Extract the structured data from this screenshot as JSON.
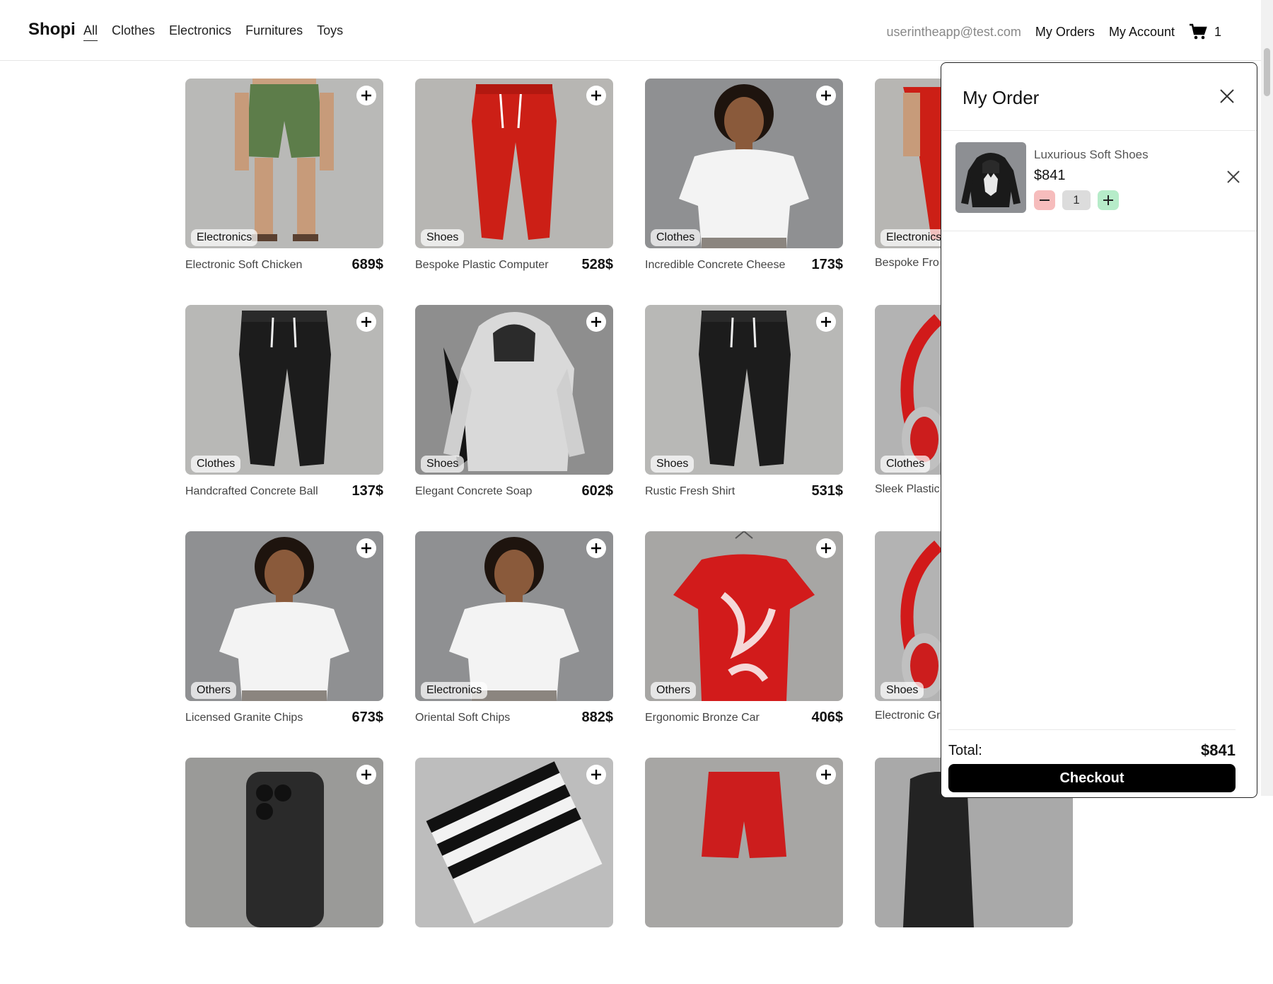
{
  "header": {
    "brand": "Shopi",
    "nav": [
      "All",
      "Clothes",
      "Electronics",
      "Furnitures",
      "Toys"
    ],
    "active_nav": "All",
    "email": "userintheapp@test.com",
    "my_orders": "My Orders",
    "my_account": "My Account",
    "cart_count": "1",
    "cart_icon": "shopping-cart-icon"
  },
  "products": [
    {
      "name": "Electronic Soft Chicken",
      "price": "689$",
      "category": "Electronics",
      "image": "green-shorts"
    },
    {
      "name": "Bespoke Plastic Computer",
      "price": "528$",
      "category": "Shoes",
      "image": "red-joggers"
    },
    {
      "name": "Incredible Concrete Cheese",
      "price": "173$",
      "category": "Clothes",
      "image": "white-tshirt-model"
    },
    {
      "name": "Bespoke Fro",
      "price": "",
      "category": "Electronics",
      "image": "red-joggers-partial"
    },
    {
      "name": "Handcrafted Concrete Ball",
      "price": "137$",
      "category": "Clothes",
      "image": "black-joggers"
    },
    {
      "name": "Elegant Concrete Soap",
      "price": "602$",
      "category": "Shoes",
      "image": "grey-hoodie"
    },
    {
      "name": "Rustic Fresh Shirt",
      "price": "531$",
      "category": "Shoes",
      "image": "black-joggers"
    },
    {
      "name": "Sleek Plastic",
      "price": "",
      "category": "Clothes",
      "image": "red-headphones"
    },
    {
      "name": "Licensed Granite Chips",
      "price": "673$",
      "category": "Others",
      "image": "white-tshirt-model"
    },
    {
      "name": "Oriental Soft Chips",
      "price": "882$",
      "category": "Electronics",
      "image": "white-tshirt-model"
    },
    {
      "name": "Ergonomic Bronze Car",
      "price": "406$",
      "category": "Others",
      "image": "red-printed-tshirt"
    },
    {
      "name": "Electronic Gr",
      "price": "",
      "category": "Shoes",
      "image": "red-headphones"
    },
    {
      "name": "",
      "price": "",
      "category": "",
      "image": "phone"
    },
    {
      "name": "",
      "price": "",
      "category": "",
      "image": "striped-item"
    },
    {
      "name": "",
      "price": "",
      "category": "",
      "image": "red-shorts"
    },
    {
      "name": "",
      "price": "",
      "category": "",
      "image": "dark-item"
    }
  ],
  "order_panel": {
    "title": "My Order",
    "close_icon": "close-icon",
    "item": {
      "name": "Luxurious Soft Shoes",
      "price": "$841",
      "quantity": "1",
      "image": "black-wolf-hoodie"
    },
    "total_label": "Total:",
    "total_value": "$841",
    "checkout_label": "Checkout"
  },
  "colors": {
    "accent": "#000000",
    "minus_bg": "#f6bcbc",
    "plus_bg": "#b6ecc9"
  }
}
